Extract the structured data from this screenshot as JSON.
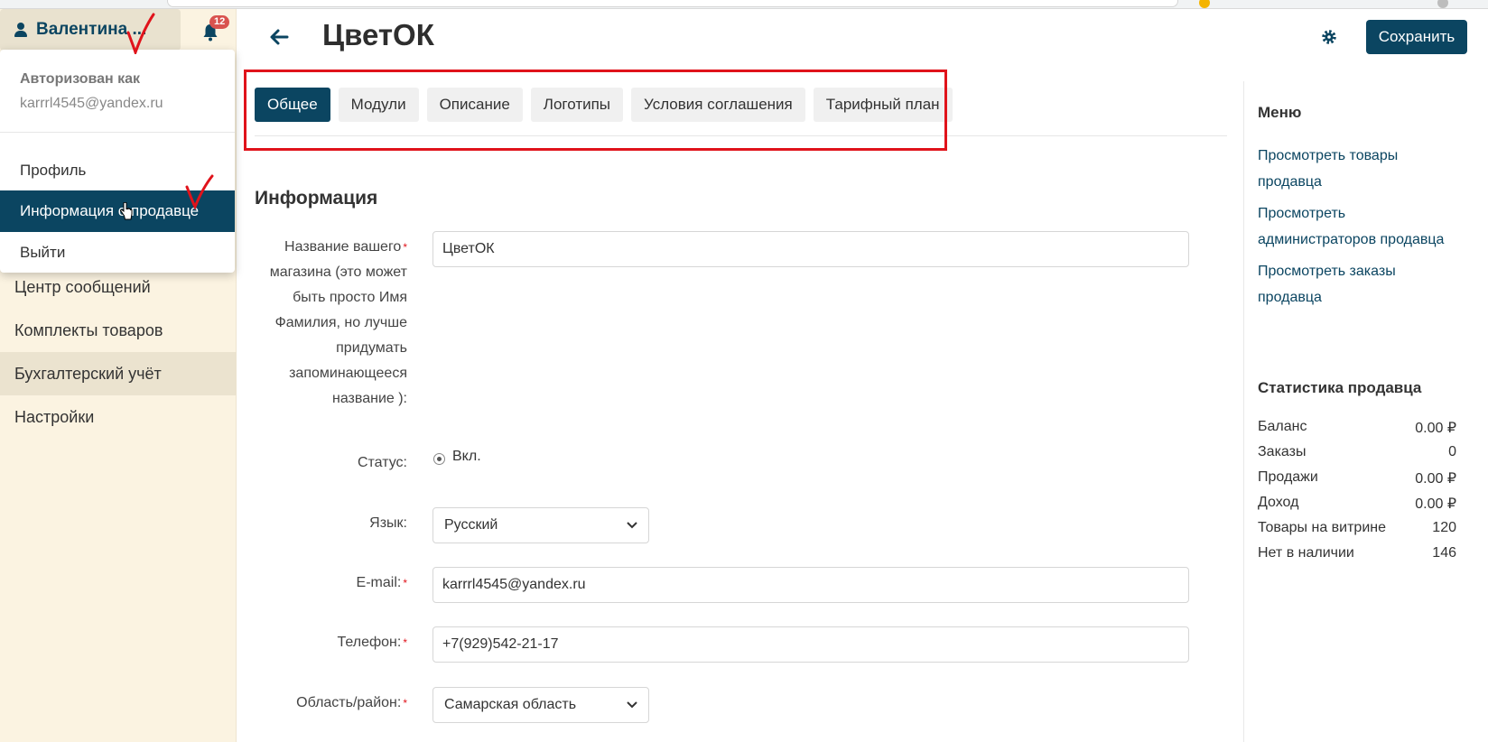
{
  "user": {
    "name": "Валентина ...",
    "notifications": "12",
    "dropdown": {
      "authorized_as": "Авторизован как",
      "email": "karrrl4545@yandex.ru",
      "items": [
        "Профиль",
        "Информация о продавце",
        "Выйти"
      ]
    }
  },
  "sidebar": {
    "items": [
      "Центр сообщений",
      "Комплекты товаров",
      "Бухгалтерский учёт",
      "Настройки"
    ]
  },
  "header": {
    "title": "ЦветОК",
    "save_label": "Сохранить"
  },
  "tabs": [
    "Общее",
    "Модули",
    "Описание",
    "Логотипы",
    "Условия соглашения",
    "Тарифный план"
  ],
  "form": {
    "section_title": "Информация",
    "store_name": {
      "label_lines": [
        "Название вашего",
        "магазина (это может",
        "быть просто Имя",
        "Фамилия, но лучше",
        "придумать",
        "запоминающееся",
        "название ):"
      ],
      "value": "ЦветОК"
    },
    "status": {
      "label": "Статус:",
      "value": "Вкл."
    },
    "language": {
      "label": "Язык:",
      "value": "Русский"
    },
    "email": {
      "label": "E-mail:",
      "value": "karrrl4545@yandex.ru"
    },
    "phone": {
      "label": "Телефон:",
      "value": "+7(929)542-21-17"
    },
    "region": {
      "label": "Область/район:",
      "value": "Самарская область"
    }
  },
  "right_panel": {
    "menu_title": "Меню",
    "links": [
      [
        "Просмотреть товары",
        "продавца"
      ],
      [
        "Просмотреть",
        "администраторов продавца"
      ],
      [
        "Просмотреть заказы",
        "продавца"
      ]
    ],
    "stats_title": "Статистика продавца",
    "stats": [
      {
        "label": "Баланс",
        "value": "0.00 ₽"
      },
      {
        "label": "Заказы",
        "value": "0"
      },
      {
        "label": "Продажи",
        "value": "0.00 ₽"
      },
      {
        "label": "Доход",
        "value": "0.00 ₽"
      },
      {
        "label": "Товары на витрине",
        "value": "120"
      },
      {
        "label": "Нет в наличии",
        "value": "146"
      }
    ]
  },
  "colors": {
    "primary": "#0b4561",
    "sidebar_bg": "#fbf3e1",
    "annotation_red": "#e0131b",
    "badge": "#d9534f"
  }
}
